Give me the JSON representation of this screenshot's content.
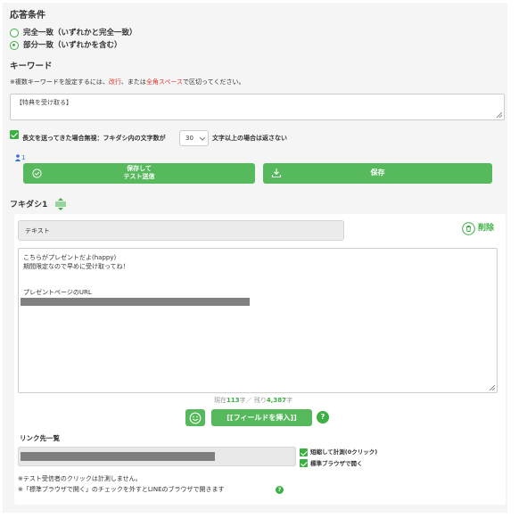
{
  "answer": {
    "heading": "応答条件",
    "option_exact": "完全一致（いずれかと完全一致）",
    "option_partial": "部分一致（いずれかを含む）"
  },
  "keyword": {
    "heading": "キーワード",
    "note_pre": "※複数キーワードを設定するには、",
    "note_red1": "改行",
    "note_mid": "、または",
    "note_red2": "全角スペース",
    "note_post": "で区切ってください。",
    "value": "【特典を受け取る】"
  },
  "long_text": {
    "label_pre": "長文を送ってきた場合無視：フキダシ内の文字数が",
    "count_value": "30",
    "label_post": "文字以上の場合は返さない"
  },
  "user_count": "1",
  "buttons": {
    "save_test_line1": "保存して",
    "save_test_line2": "テスト送信",
    "save": "保存"
  },
  "bubble": {
    "heading": "フキダシ1",
    "type_value": "テキスト",
    "delete_label": "削除",
    "message_line1": "こちらがプレゼントだよ(happy)",
    "message_line2": "期間限定なので早めに受け取ってね！",
    "message_line3": "プレゼントページのURL",
    "count_pre": "現在",
    "count_current": "113",
    "count_mid": "字／ 残り",
    "count_remaining": "4,387",
    "count_post": "字",
    "insert_field": "[[フィールドを挿入]]",
    "help_glyph": "?"
  },
  "links": {
    "heading": "リンク先一覧",
    "shorten_label": "短縮して計測(0クリック)",
    "standard_browser_label": "標準ブラウザで開く",
    "note1": "※テスト受信者のクリックは計測しません。",
    "note2": "※「標準ブラウザで開く」のチェックを外すとLINEのブラウザで開きます"
  },
  "colors": {
    "accent_green": "#3cb043",
    "button_green": "#56b95c",
    "warning_red": "#e53935",
    "redacted_grey": "#808080"
  },
  "icons": [
    "check-circle-icon",
    "download-icon",
    "drag-handle-icon",
    "trash-icon",
    "smiley-icon",
    "help-icon",
    "person-icon"
  ]
}
